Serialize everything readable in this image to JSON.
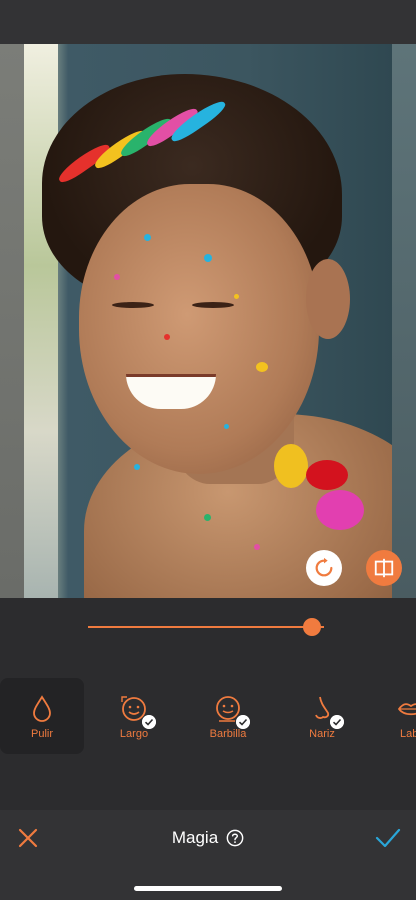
{
  "colors": {
    "accent": "#f07b3f",
    "background": "#2c2c2e",
    "bar": "#333335"
  },
  "photo": {
    "subject_icon": "photo-preview"
  },
  "controls": {
    "reset_icon": "rotate-icon",
    "compare_icon": "compare-icon"
  },
  "slider": {
    "value_fraction": 0.95
  },
  "tools": [
    {
      "label": "Pulir",
      "icon": "drop-icon",
      "active": true
    },
    {
      "label": "Largo",
      "icon": "face-icon",
      "checked": true
    },
    {
      "label": "Barbilla",
      "icon": "face-icon",
      "checked": true
    },
    {
      "label": "Nariz",
      "icon": "nose-icon",
      "checked": true
    },
    {
      "label": "Lab",
      "icon": "lips-icon"
    }
  ],
  "footer": {
    "title": "Magia",
    "cancel_icon": "close-icon",
    "confirm_icon": "check-icon",
    "help_icon": "help-icon"
  }
}
